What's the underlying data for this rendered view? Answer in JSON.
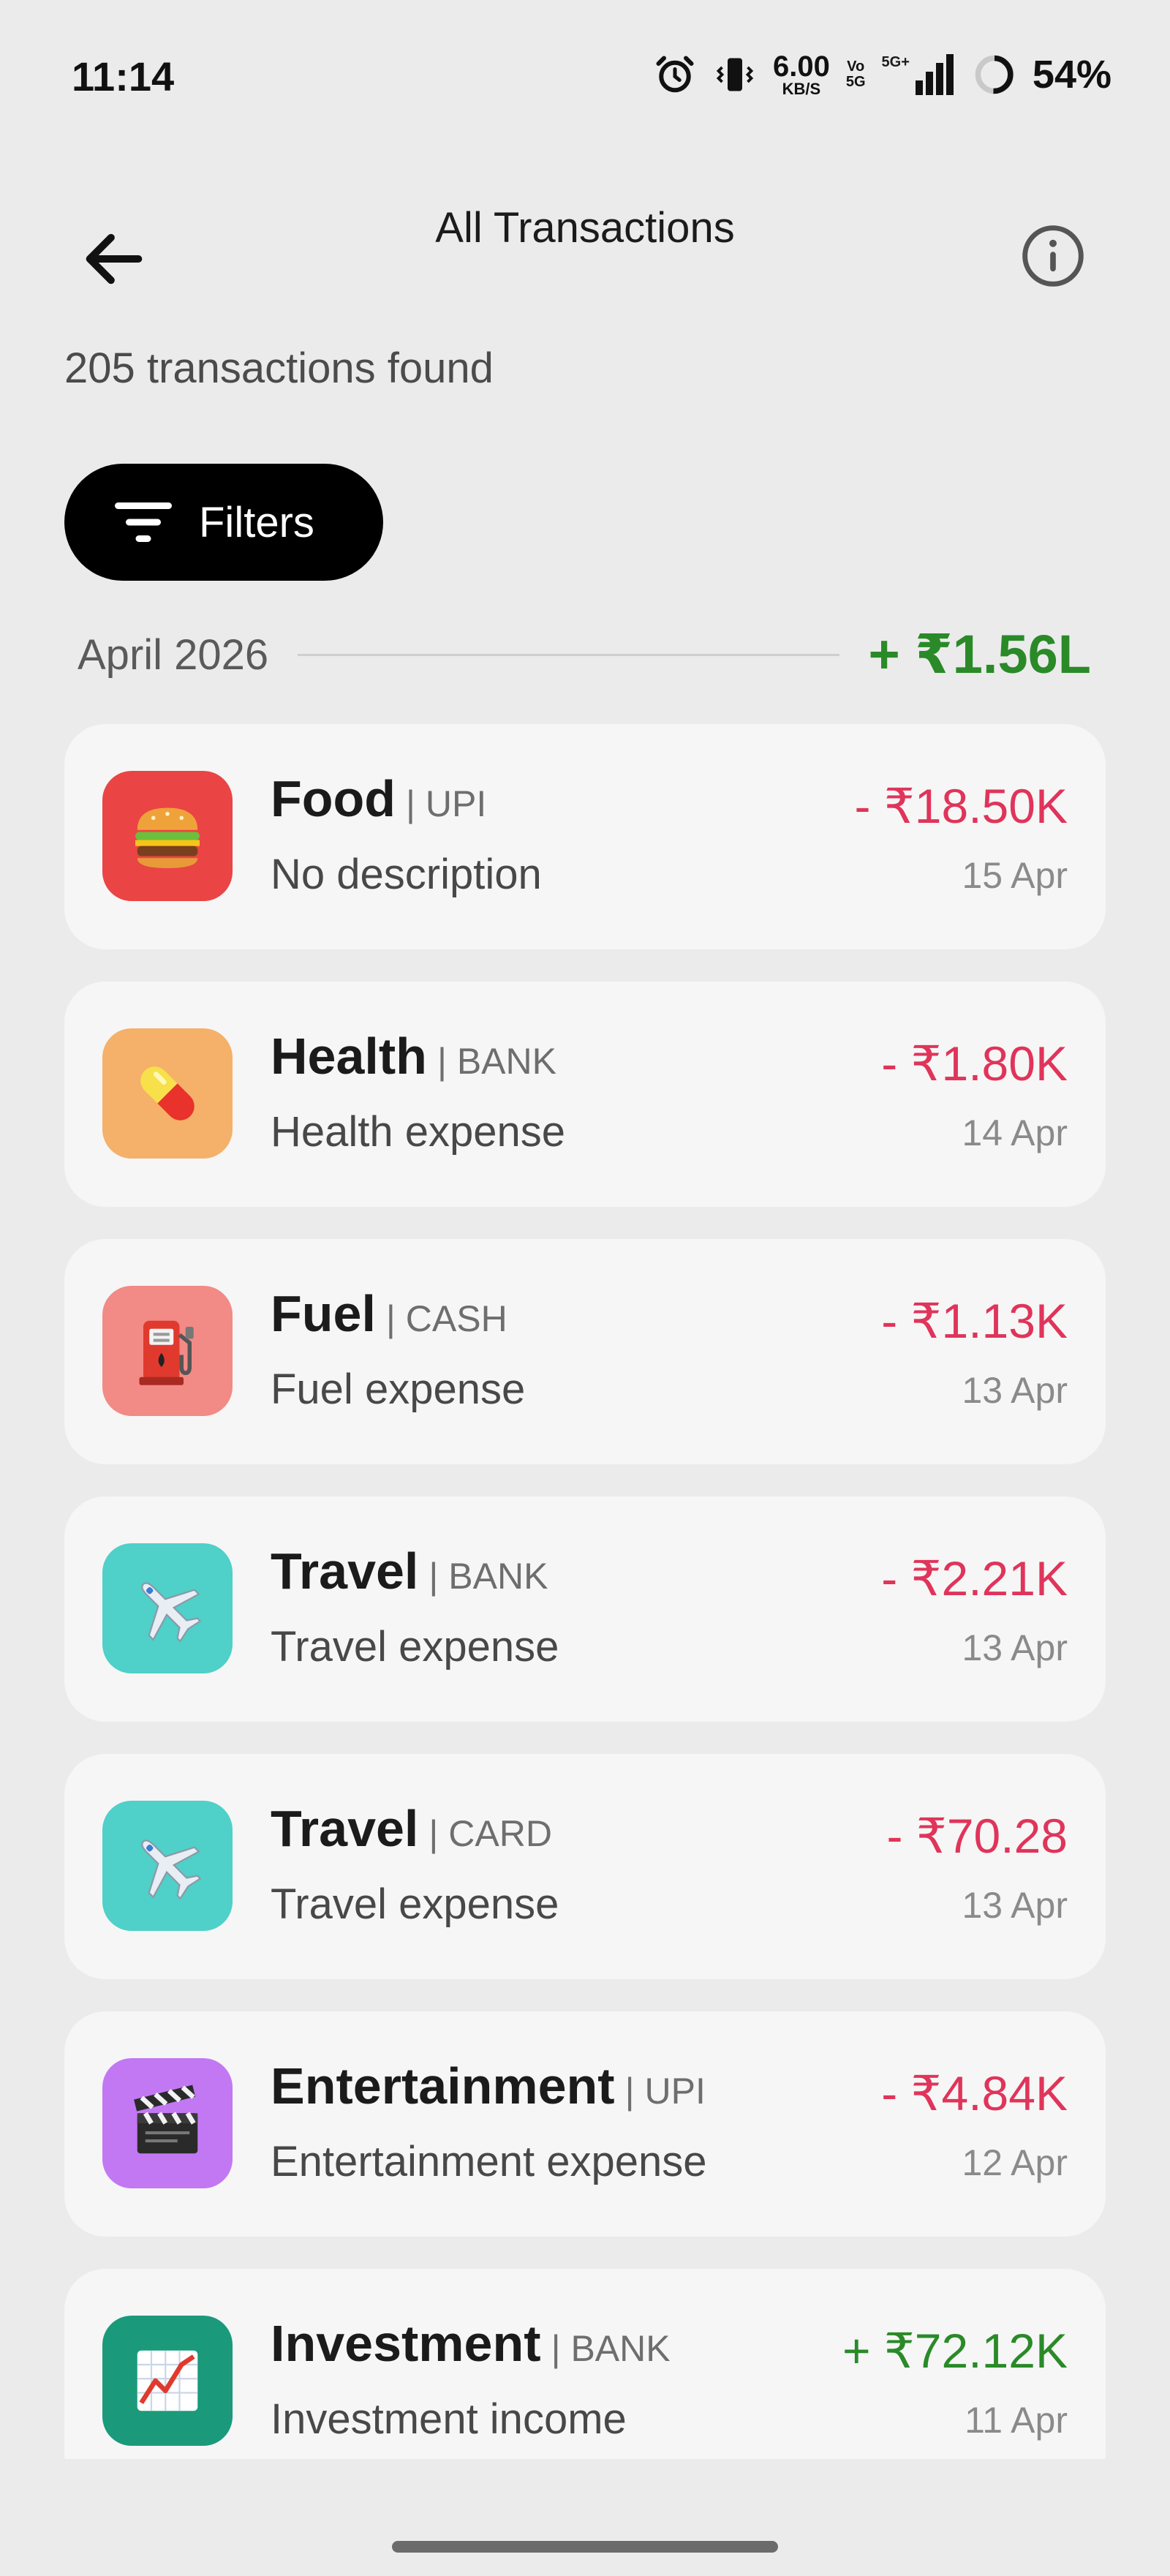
{
  "status_bar": {
    "time": "11:14",
    "net_speed_value": "6.00",
    "net_speed_unit": "KB/S",
    "volte_top": "Vo",
    "volte_bottom": "5G",
    "network": "5G+",
    "battery_percent": "54%"
  },
  "header": {
    "title": "All Transactions",
    "back_icon": "arrow-left-icon",
    "info_icon": "info-icon"
  },
  "summary": {
    "count_text": "205 transactions found"
  },
  "filters": {
    "label": "Filters",
    "icon": "filter-lines-icon"
  },
  "month_group": {
    "label": "April 2026",
    "total": "+ ₹1.56L"
  },
  "transactions": [
    {
      "category": "Food",
      "method": "| UPI",
      "description": "No description",
      "amount": "- ₹18.50K",
      "date": "15 Apr",
      "type": "expense",
      "icon": "burger-icon",
      "icon_bg": "#ea4444"
    },
    {
      "category": "Health",
      "method": "| BANK",
      "description": "Health expense",
      "amount": "- ₹1.80K",
      "date": "14 Apr",
      "type": "expense",
      "icon": "pill-icon",
      "icon_bg": "#f5b06a"
    },
    {
      "category": "Fuel",
      "method": "| CASH",
      "description": "Fuel expense",
      "amount": "- ₹1.13K",
      "date": "13 Apr",
      "type": "expense",
      "icon": "fuel-pump-icon",
      "icon_bg": "#f28a86"
    },
    {
      "category": "Travel",
      "method": "| BANK",
      "description": "Travel expense",
      "amount": "- ₹2.21K",
      "date": "13 Apr",
      "type": "expense",
      "icon": "airplane-icon",
      "icon_bg": "#4fd0c8"
    },
    {
      "category": "Travel",
      "method": "| CARD",
      "description": "Travel expense",
      "amount": "- ₹70.28",
      "date": "13 Apr",
      "type": "expense",
      "icon": "airplane-icon",
      "icon_bg": "#4fd0c8"
    },
    {
      "category": "Entertainment",
      "method": "| UPI",
      "description": "Entertainment expense",
      "amount": "- ₹4.84K",
      "date": "12 Apr",
      "type": "expense",
      "icon": "clapperboard-icon",
      "icon_bg": "#c278f2"
    },
    {
      "category": "Investment",
      "method": "| BANK",
      "description": "Investment income",
      "amount": "+ ₹72.12K",
      "date": "11 Apr",
      "type": "income",
      "icon": "chart-up-icon",
      "icon_bg": "#1a9a7a"
    }
  ],
  "colors": {
    "expense": "#e0345a",
    "income": "#2a8a28",
    "card_bg": "#f6f6f6",
    "page_bg": "#ebebeb"
  }
}
